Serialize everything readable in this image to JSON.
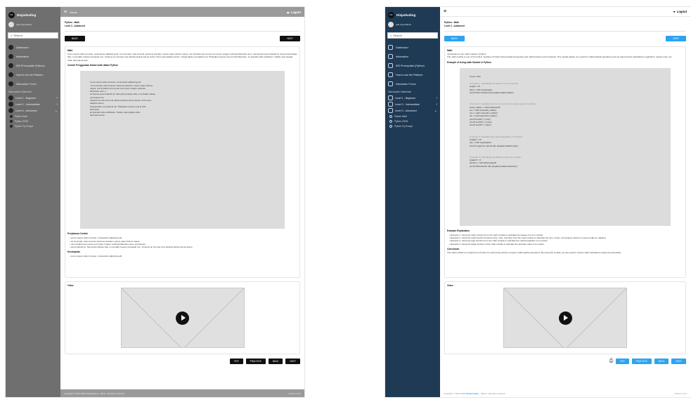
{
  "frames": [
    {
      "brand": "Disjarkoding",
      "brand_logo": "DK",
      "user_name": "Ade Anya Rimini",
      "search_placeholder": "Search",
      "nav": [
        "Dashboard",
        "Information",
        "IDE Prerequisite (Python)",
        "How to use the Platform",
        "Discussion Forum"
      ],
      "section_label": "Discussion Materials",
      "levels": [
        "Level 1 - Beginner",
        "Level 2 - Intermediate",
        "Level 3 - Advanced"
      ],
      "sub_items": [
        "Python Math",
        "Python JSON",
        "Python Try Except"
      ],
      "topbar_title": "Home",
      "logout": "Logout",
      "breadcrumb": [
        "Python - Math",
        "Level 3 - Advanced"
      ],
      "back": "BACK",
      "next": "NEXT",
      "content_title": "Math",
      "content_para": "Lorem ipsum dolor sit amet, consectetur adipiscing elit. Ut commodo, felis sit amet maximus interdum, ipsum quam dictum neque, nec tincidunt arcu purus non turpis. Integer vehicula bibendum arcu, sed laoreet purus blandit sit. Sed porta tristique felis, a convallis massa consequat non. Vivamus ac nisi sed urna ultricies lacinia sed ac lectus. Proin quis dapibus ipsum. Suspendisse vel eleifend est. Phasellus tempus uma id velit bibendum, ac gravida nulla vestibulum. Nullam quis feugiat nulla. Sed elementum.",
      "example_title": "Contoh Penggunaan Modul math dalam Python",
      "code_lines": [
        "Lorem ipsum dolor sit amet, consectetur adipiscing elit.",
        " Ut commodo, felis sit amet maximus interdum, ipsum quam dictum",
        "neque, nec tincidunt arcu purus non turpis. Integer vehicula",
        "bibendum arcu, s",
        "ed laoreet purus blandit sit. Sed porta tristique felis, a convallis massa",
        "consequat non.",
        "Vivamus ac nisi sed urna ultricies lacinia sed ac lectus. Proin quis",
        "dapibus ipsum.",
        "Suspendisse vel eleifend est. Phasellus tempus uma id velit",
        "bibendum,",
        "ac gravida nulla vestibulum. Nullam quis feugiat nulla.",
        "Sed elementum."
      ],
      "explanation_title": "Penjelasan Contoh",
      "explanation_items": [
        "Lorem ipsum dolor sit amet, consectetur adipiscing elit.",
        "Ut commodo, felis sit amet maximus interdum, ipsum quam dictum neque,",
        "nec tincidunt arcu purus non turpis. Integer vehicula bibendum arcu, sed laoreet",
        "purus blandit sit. Sed porta tristique felis, a convallis massa consequat non. Vivamus ac nisi sed urna ultricies lacinia sed ac lectus."
      ],
      "conclusion_title": "Kesimpulan",
      "conclusion_items": [
        "Lorem ipsum dolor sit amet, consectetur adipiscing elit."
      ],
      "video_label": "Video",
      "bottom_buttons": [
        "PDF",
        "PRACTICE",
        "BACK",
        "NEXT"
      ],
      "footer_left": "Copyright © 2024-2025 Disjarkoding - Yakum. All rights reserved.",
      "footer_right": "Version 1.0.0"
    },
    {
      "brand": "Disjarkoding",
      "brand_logo": "DK",
      "user_name": "Ade Anya Rimini",
      "search_placeholder": "Search",
      "nav": [
        "Dashboard",
        "Information",
        "IDE Prerequisite (Python)",
        "How to use the Platform",
        "Discussion Forum"
      ],
      "section_label": "Discussion Materials",
      "levels": [
        "Level 1 - Beginner",
        "Level 2 - Intermediate",
        "Level 3 - Advanced"
      ],
      "sub_items": [
        "Python Math",
        "Python JSON",
        "Python Try Except"
      ],
      "logout": "Logout",
      "breadcrumb": [
        "Python - Math",
        "Level 3 - Advanced"
      ],
      "back": "BACK",
      "next": "NEXT",
      "content_title": "Math",
      "content_subtitle": "Introduction to the math module in Python",
      "content_para": "The math module is one of the built-in modules in Python that provides frequently used math functions and constants. This module allows us to perform mathematical operations such as trigonometric calculations, logarithms, square roots, etc.",
      "example_title": "Example of Using math Module in Python",
      "code_lines": [
        "import math",
        "",
        "# Contoh 1: Calculating the square root of a number",
        "angka = 16",
        "akar = math.sqrt(angka)",
        "print(f\"Akar kuadrat dari {angka} adalah {akar}\")",
        "",
        "",
        "# Contoh 2: Calculate the sin, cos, and tan of a given angle (in radians)",
        "sudut_radian = math.radians(30)",
        "sin = math.sin(sudut_radian)",
        "cos = math.cos(sudut_radian)",
        "tan = math.tan(sudut_radian)",
        "print(f\"sin(30°) = {sin}\")",
        "print(f\"cos(30°) = {cos}\")",
        "print(f\"tan(30°) = {tan}\")",
        "",
        "",
        "# Contoh 3: Calculates the natural logarithm of a number",
        "angka2 = 10",
        "log = math.log(angka2)",
        "print(f\"Logaritma natural dari {angka2} adalah {log}\")",
        "",
        "",
        "# Contoh 4: Calculating the absolute value of a number",
        "angka3 = -5",
        "absolut = math.fabs(angka3)",
        "print(f\"Nilai absolut dari {angka3} adalah {absolut}\")"
      ],
      "explanation_title": "Example Explanation",
      "explanation_items": [
        "Example 1: Using the sqrt() function from the math module to calculate the square root of a number.",
        "Example 2: Using the trigonometric functions sin(), cos(), and tan() from the math module to calculate the sine, cosine, and tangent values of a given angle (in radians).",
        "Example 3: Using the log() function from the math module to calculate the natural logarithm of a number.",
        "Example 4: Using the fabs() function of the math module to calculate the absolute value of a number."
      ],
      "conclusion_title": "Conclusion",
      "conclusion_para": "The math module is a useful tool in Python for performing various complex mathematical operations. By using this module, we can perform various math calculations easily and accurately.",
      "video_label": "Video",
      "bottom_buttons": [
        "PDF",
        "PRACTICE",
        "BACK",
        "NEXT"
      ],
      "footer_brand": "Disjarkoding",
      "footer_left_pre": "Copyright © 2024-2025",
      "footer_left_post": "- Yakum. All rights reserved.",
      "footer_right": "Version 1.0.0"
    }
  ]
}
